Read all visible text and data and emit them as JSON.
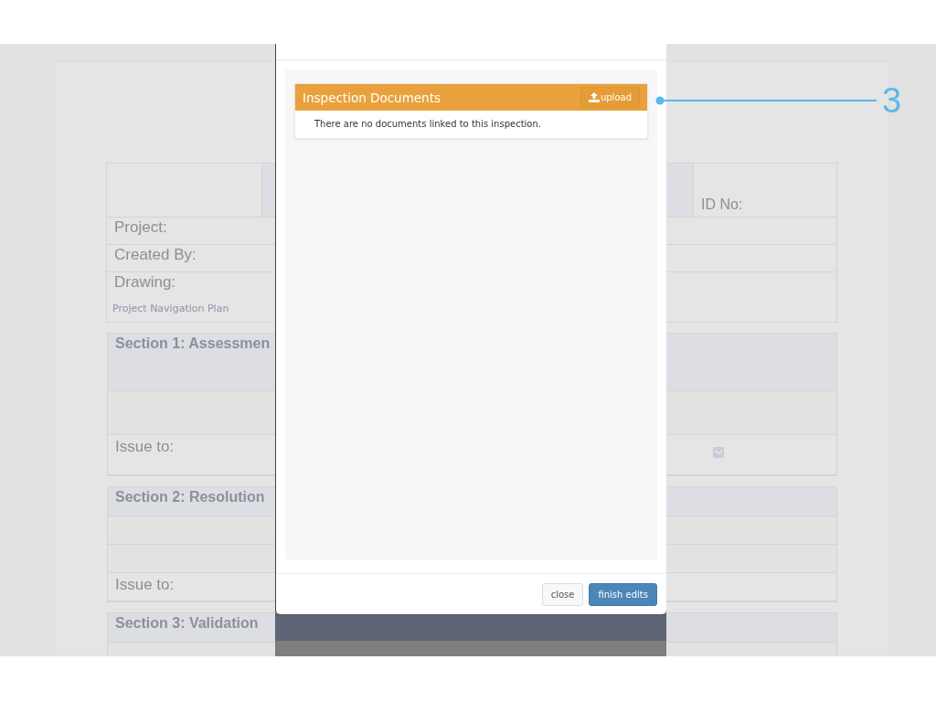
{
  "form": {
    "id_label": "ID No:",
    "fields": [
      {
        "label": "Project:"
      },
      {
        "label": "Created By:"
      },
      {
        "label": "Drawing:",
        "value": "Project Navigation Plan"
      }
    ],
    "sections": [
      {
        "title": "Section 1: Assessmen",
        "rows": [
          {
            "kind": "blank"
          },
          {
            "kind": "issue",
            "label": "Issue to:",
            "mail": true
          }
        ]
      },
      {
        "title": "Section 2: Resolution",
        "rows": [
          {
            "kind": "blank"
          },
          {
            "kind": "blank"
          },
          {
            "kind": "issue",
            "label": "Issue to:",
            "mail": false
          }
        ]
      },
      {
        "title": "Section 3: Validation",
        "rows": [
          {
            "kind": "blank"
          }
        ]
      }
    ]
  },
  "modal": {
    "panel": {
      "title": "Inspection Documents",
      "button": "upload",
      "message": "There are no documents linked to this inspection."
    },
    "buttons": [
      {
        "label": "close",
        "kind": "default"
      },
      {
        "label": "finish edits",
        "kind": "primary"
      }
    ]
  },
  "callout": {
    "number": "3"
  }
}
